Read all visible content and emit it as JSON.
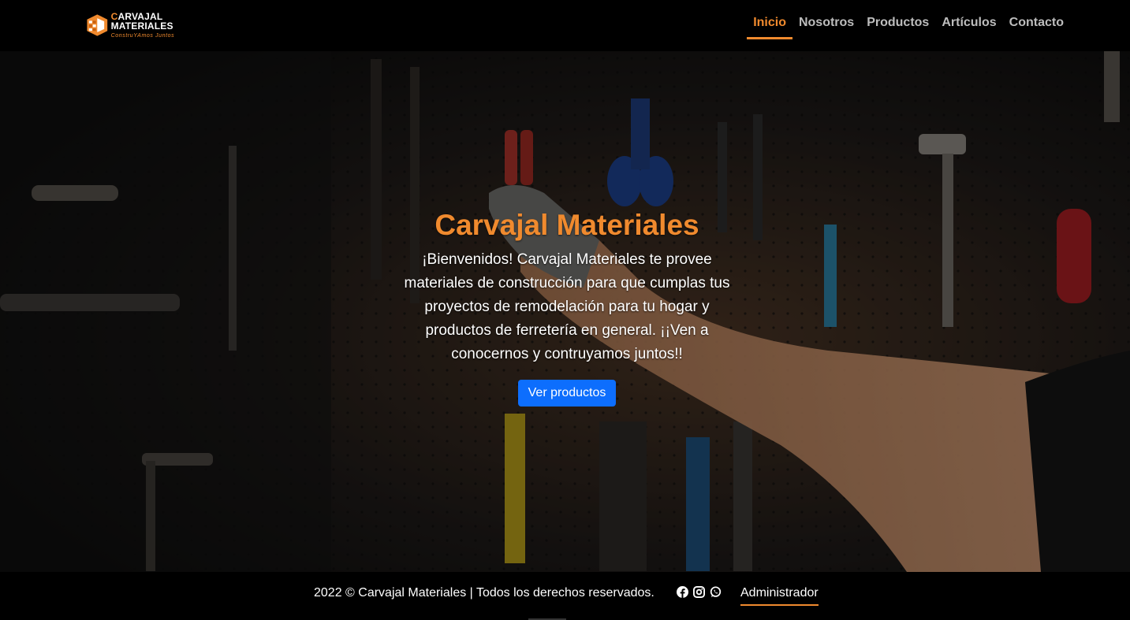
{
  "brand": {
    "name_first": "C",
    "name_rest": "ARVAJAL MATERIALES",
    "slogan": "ConstruYAmos Juntos",
    "accent_color": "#f08a2e"
  },
  "nav": {
    "items": [
      {
        "label": "Inicio",
        "active": true
      },
      {
        "label": "Nosotros",
        "active": false
      },
      {
        "label": "Productos",
        "active": false
      },
      {
        "label": "Artículos",
        "active": false
      },
      {
        "label": "Contacto",
        "active": false
      }
    ]
  },
  "hero": {
    "title": "Carvajal Materiales",
    "text": "¡Bienvenidos! Carvajal Materiales te provee materiales de construcción para que cumplas tus proyectos de remodelación para tu hogar y productos de ferretería en general. ¡¡Ven a conocernos y contruyamos juntos!!",
    "button_label": "Ver productos",
    "button_color": "#0d6efd"
  },
  "footer": {
    "copyright": "2022 © Carvajal Materiales | Todos los derechos reservados.",
    "social_icons": [
      "facebook-icon",
      "instagram-icon",
      "whatsapp-icon"
    ],
    "admin_label": "Administrador"
  }
}
